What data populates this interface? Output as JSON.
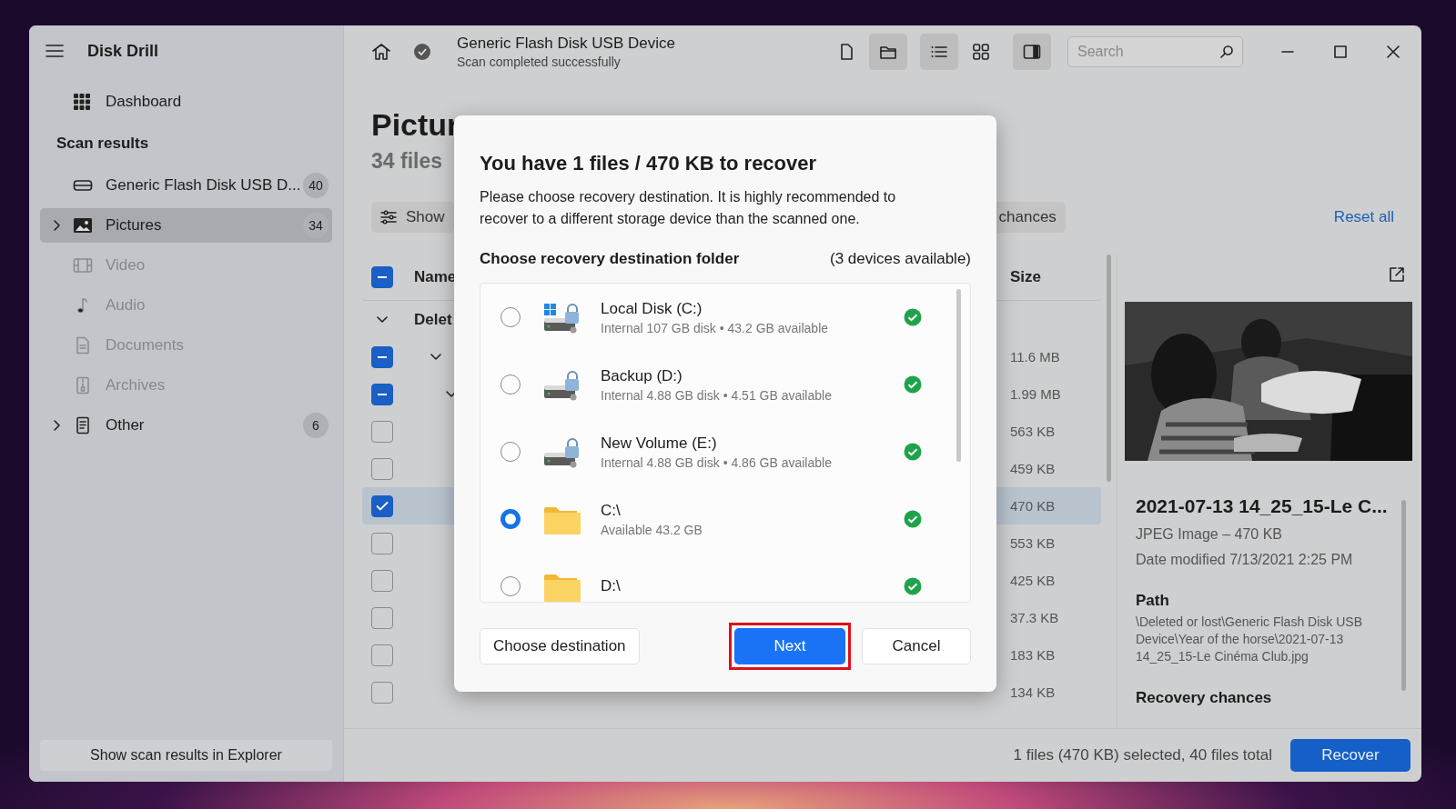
{
  "sidebar": {
    "app_title": "Disk Drill",
    "items": [
      {
        "label": "Dashboard",
        "kind": "item",
        "selected": false,
        "disabled": false,
        "expandable": false
      },
      {
        "label": "Scan results",
        "kind": "section"
      },
      {
        "label": "Generic Flash Disk USB D...",
        "kind": "item",
        "count": "40",
        "selected": false,
        "disabled": false,
        "expandable": false
      },
      {
        "label": "Pictures",
        "kind": "item",
        "count": "34",
        "selected": true,
        "disabled": false,
        "expandable": true
      },
      {
        "label": "Video",
        "kind": "item",
        "selected": false,
        "disabled": true,
        "expandable": false
      },
      {
        "label": "Audio",
        "kind": "item",
        "selected": false,
        "disabled": true,
        "expandable": false
      },
      {
        "label": "Documents",
        "kind": "item",
        "selected": false,
        "disabled": true,
        "expandable": false
      },
      {
        "label": "Archives",
        "kind": "item",
        "selected": false,
        "disabled": true,
        "expandable": false
      },
      {
        "label": "Other",
        "kind": "item",
        "count": "6",
        "selected": false,
        "disabled": false,
        "expandable": true
      }
    ],
    "footer_button": "Show scan results in Explorer"
  },
  "topbar": {
    "title": "Generic Flash Disk USB Device",
    "subtitle": "Scan completed successfully",
    "view_buttons": [
      {
        "selected": false
      },
      {
        "selected": true
      },
      {
        "selected": true
      },
      {
        "selected": false
      },
      {
        "selected": true
      }
    ],
    "search": {
      "placeholder": "Search"
    }
  },
  "header": {
    "title": "Pictur",
    "subtitle": "34 files",
    "show_button": "Show",
    "chances_button": "chances",
    "reset_link": "Reset all"
  },
  "table": {
    "header_checked": true,
    "header_mixed": true,
    "columns": [
      "Name",
      "Size"
    ],
    "rows": [
      {
        "kind": "group",
        "label": "Delet",
        "expanded": true,
        "children": [
          {
            "kind": "folder",
            "checked": true,
            "mixed": true,
            "size": "11.6 MB",
            "selected": false,
            "expanded": true,
            "children": [
              {
                "kind": "folder",
                "checked": true,
                "mixed": true,
                "size": "1.99 MB",
                "selected": false,
                "expanded": true,
                "children": [
                  {
                    "kind": "file",
                    "checked": false,
                    "size": "563 KB",
                    "selected": false
                  },
                  {
                    "kind": "file",
                    "checked": false,
                    "size": "459 KB",
                    "selected": false
                  },
                  {
                    "kind": "file",
                    "checked": true,
                    "size": "470 KB",
                    "selected": true
                  },
                  {
                    "kind": "file",
                    "checked": false,
                    "size": "553 KB",
                    "selected": false
                  },
                  {
                    "kind": "file",
                    "checked": false,
                    "size": "425 KB",
                    "selected": false
                  },
                  {
                    "kind": "file",
                    "checked": false,
                    "size": "37.3 KB",
                    "selected": false
                  },
                  {
                    "kind": "file",
                    "checked": false,
                    "size": "183 KB",
                    "selected": false
                  },
                  {
                    "kind": "file",
                    "checked": false,
                    "size": "134 KB",
                    "selected": false
                  }
                ]
              }
            ]
          }
        ]
      }
    ]
  },
  "preview": {
    "filename": "2021-07-13 14_25_15-Le C...",
    "type_size": "JPEG Image – 470 KB",
    "modified": "Date modified 7/13/2021 2:25 PM",
    "path_label": "Path",
    "path": "\\Deleted or lost\\Generic Flash Disk USB Device\\Year of the horse\\2021-07-13 14_25_15-Le Cinéma Club.jpg",
    "chances_label": "Recovery chances"
  },
  "status_bar": {
    "summary": "1 files (470 KB) selected, 40 files total",
    "recover_button": "Recover"
  },
  "dialog": {
    "title": "You have 1 files / 470 KB to recover",
    "description": "Please choose recovery destination. It is highly recommended to recover to a different storage device than the scanned one.",
    "list_label": "Choose recovery destination folder",
    "available": "(3 devices available)",
    "destinations": [
      {
        "kind": "system",
        "name": "Local Disk (C:)",
        "detail": "Internal 107 GB disk • 43.2 GB available",
        "selected": false,
        "ok": true
      },
      {
        "kind": "drive",
        "name": "Backup (D:)",
        "detail": "Internal 4.88 GB disk • 4.51 GB available",
        "selected": false,
        "ok": true
      },
      {
        "kind": "drive",
        "name": "New Volume (E:)",
        "detail": "Internal 4.88 GB disk • 4.86 GB available",
        "selected": false,
        "ok": true
      },
      {
        "kind": "folder",
        "name": "C:\\",
        "detail": "Available 43.2 GB",
        "selected": true,
        "ok": true
      },
      {
        "kind": "folder",
        "name": "D:\\",
        "selected": false,
        "ok": true
      }
    ],
    "buttons": [
      {
        "label": "Choose destination",
        "kind": "secondary",
        "highlighted": false
      },
      {
        "label": "Next",
        "kind": "primary",
        "highlighted": true
      },
      {
        "label": "Cancel",
        "kind": "secondary",
        "highlighted": false
      }
    ]
  }
}
